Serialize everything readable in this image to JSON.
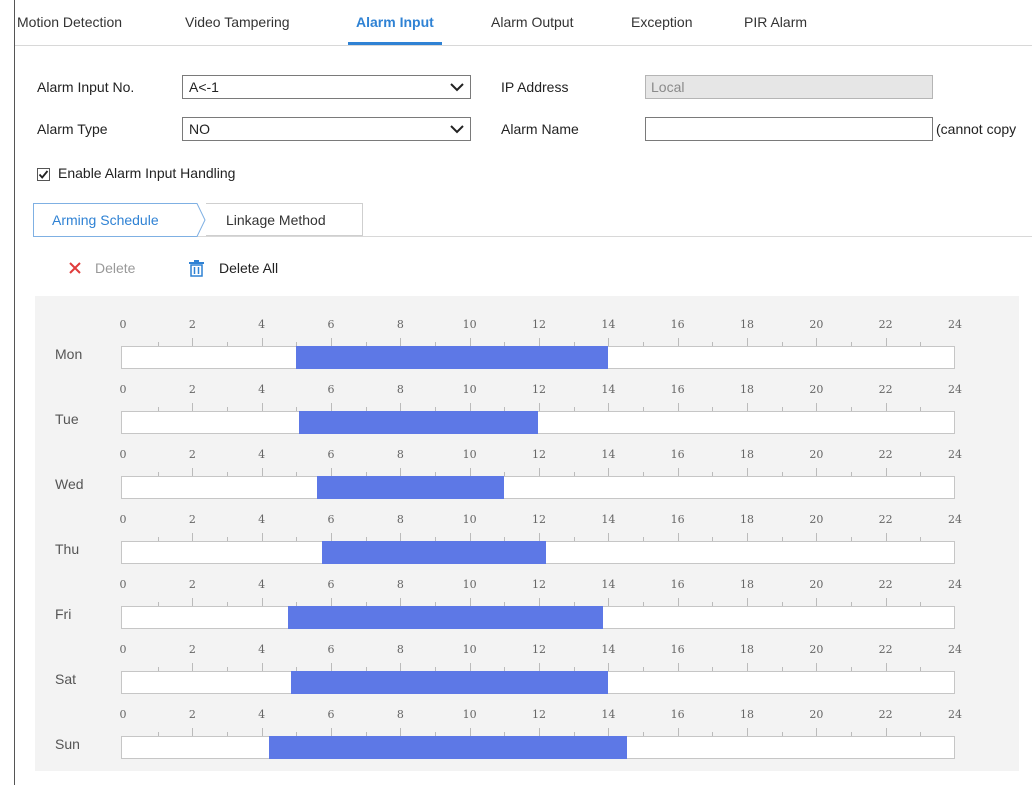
{
  "tabs": [
    {
      "label": "Motion Detection",
      "active": false
    },
    {
      "label": "Video Tampering",
      "active": false
    },
    {
      "label": "Alarm Input",
      "active": true
    },
    {
      "label": "Alarm Output",
      "active": false
    },
    {
      "label": "Exception",
      "active": false
    },
    {
      "label": "PIR Alarm",
      "active": false
    }
  ],
  "form": {
    "alarm_input_no_label": "Alarm Input No.",
    "alarm_input_no_value": "A<-1",
    "ip_address_label": "IP Address",
    "ip_address_value": "Local",
    "alarm_type_label": "Alarm Type",
    "alarm_type_value": "NO",
    "alarm_name_label": "Alarm Name",
    "alarm_name_value": "",
    "alarm_name_hint": "(cannot copy",
    "enable_label": "Enable Alarm Input Handling",
    "enable_checked": true
  },
  "subtabs": {
    "arming_schedule": "Arming Schedule",
    "linkage_method": "Linkage Method"
  },
  "toolbar": {
    "delete_label": "Delete",
    "delete_all_label": "Delete All"
  },
  "schedule": {
    "tick_labels": [
      "0",
      "2",
      "4",
      "6",
      "8",
      "10",
      "12",
      "14",
      "16",
      "18",
      "20",
      "22",
      "24"
    ],
    "days": [
      {
        "name": "Mon",
        "start": 5.0,
        "end": 13.98
      },
      {
        "name": "Tue",
        "start": 5.08,
        "end": 11.98
      },
      {
        "name": "Wed",
        "start": 5.6,
        "end": 10.98
      },
      {
        "name": "Thu",
        "start": 5.75,
        "end": 12.2
      },
      {
        "name": "Fri",
        "start": 4.75,
        "end": 13.85
      },
      {
        "name": "Sat",
        "start": 4.85,
        "end": 13.98
      },
      {
        "name": "Sun",
        "start": 4.2,
        "end": 14.55
      }
    ]
  },
  "colors": {
    "accent": "#2f82d4",
    "segment": "#5d78e6",
    "delete_icon": "#e03c3c"
  }
}
